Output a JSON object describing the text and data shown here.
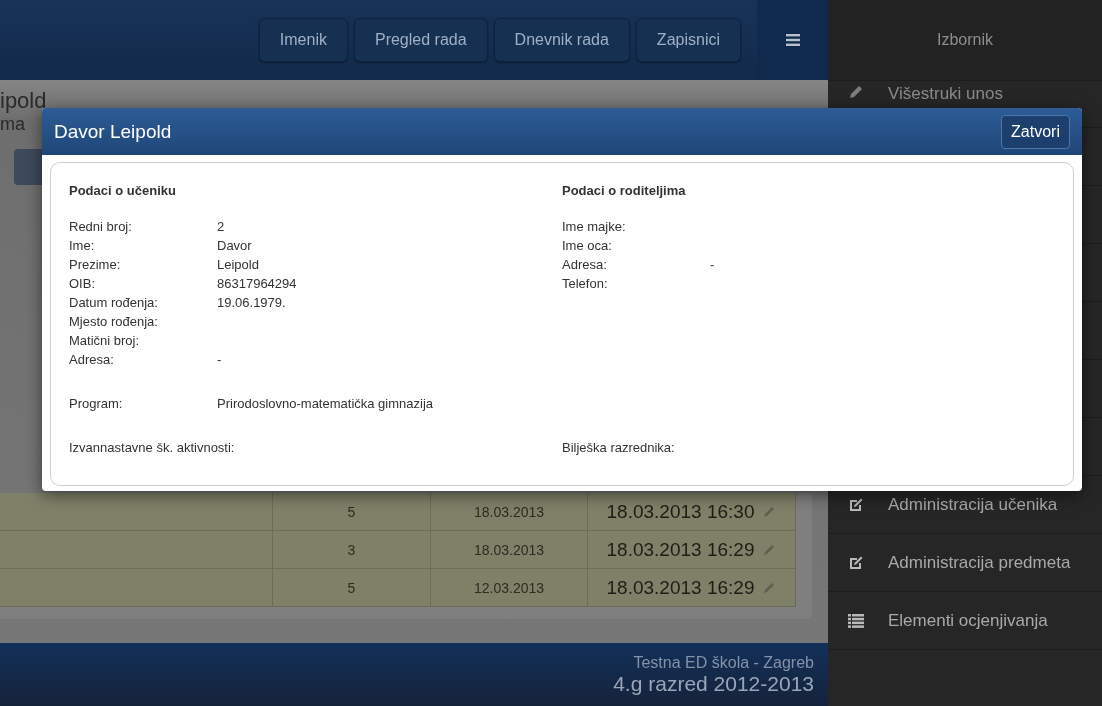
{
  "nav": {
    "tabs": [
      {
        "label": "Imenik"
      },
      {
        "label": "Pregled rada"
      },
      {
        "label": "Dnevnik rada"
      },
      {
        "label": "Zapisnici"
      }
    ]
  },
  "sidebar": {
    "title": "Izbornik",
    "items": [
      {
        "label": "Višestruki unos",
        "kind": "pencil"
      },
      {
        "label": "Administracija učenika",
        "kind": "edit"
      },
      {
        "label": "Administracija predmeta",
        "kind": "edit"
      },
      {
        "label": "Elementi ocjenjivanja",
        "kind": "list"
      }
    ]
  },
  "page": {
    "heading": "ipold",
    "subheading": "ma"
  },
  "table": {
    "rows": [
      {
        "grade": "5",
        "date": "18.03.2013",
        "entered": "18.03.2013 16:30"
      },
      {
        "grade": "3",
        "date": "18.03.2013",
        "entered": "18.03.2013 16:29"
      },
      {
        "grade": "5",
        "date": "12.03.2013",
        "entered": "18.03.2013 16:29"
      }
    ]
  },
  "footer": {
    "school": "Testna ED škola - Zagreb",
    "class": "4.g razred 2012-2013"
  },
  "modal": {
    "title": "Davor Leipold",
    "close_button": "Zatvori",
    "student": {
      "title": "Podaci o učeniku",
      "fields": [
        {
          "label": "Redni broj:",
          "value": "2"
        },
        {
          "label": "Ime:",
          "value": "Davor"
        },
        {
          "label": "Prezime:",
          "value": "Leipold"
        },
        {
          "label": "OIB:",
          "value": "86317964294"
        },
        {
          "label": "Datum rođenja:",
          "value": "19.06.1979."
        },
        {
          "label": "Mjesto rođenja:"
        },
        {
          "label": "Matični broj:"
        },
        {
          "label": "Adresa:",
          "value": "-"
        }
      ],
      "program": {
        "label": "Program:",
        "value": "Prirodoslovno-matematička gimnazija"
      },
      "activities": {
        "label": "Izvannastavne šk. aktivnosti:"
      }
    },
    "parents": {
      "title": "Podaci o roditeljima",
      "fields": [
        {
          "label": "Ime majke:"
        },
        {
          "label": "Ime oca:"
        },
        {
          "label": "Adresa:",
          "value": "-"
        },
        {
          "label": "Telefon:"
        }
      ],
      "note": {
        "label": "Bilješka razrednika:"
      }
    }
  }
}
